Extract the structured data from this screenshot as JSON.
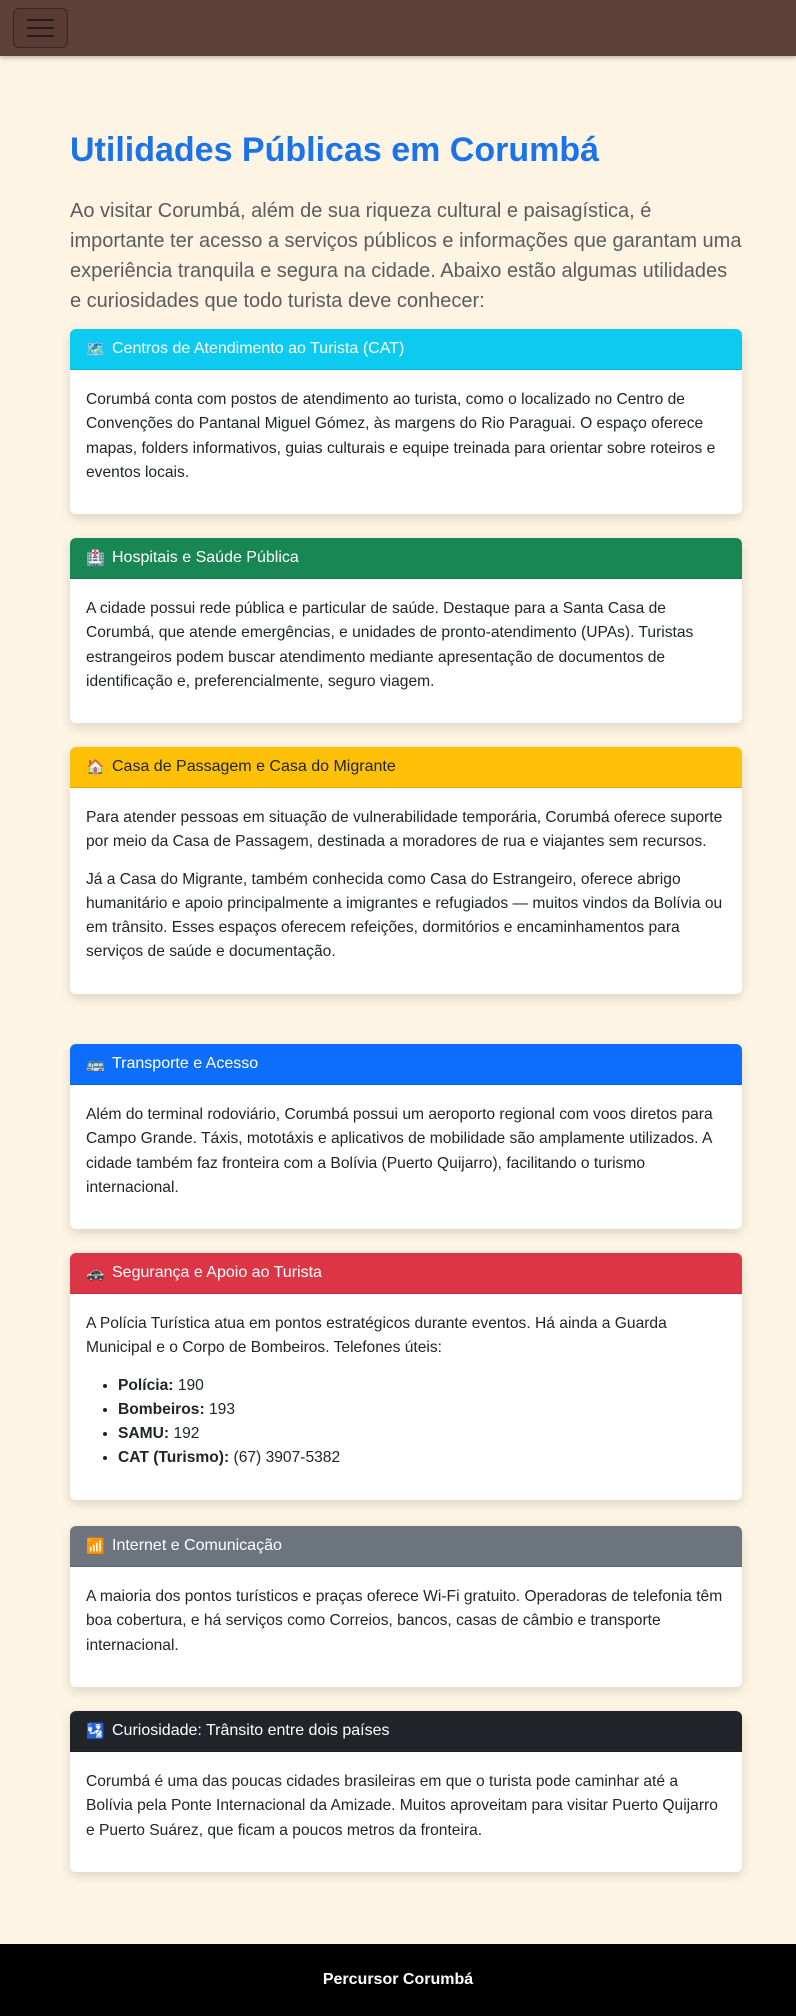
{
  "navbar": {
    "toggle_icon": "hamburger-icon"
  },
  "main": {
    "title": "Utilidades Públicas em Corumbá",
    "intro": "Ao visitar Corumbá, além de sua riqueza cultural e paisagística, é importante ter acesso a serviços públicos e informações que garantam uma experiência tranquila e segura na cidade. Abaixo estão algumas utilidades e curiosidades que todo turista deve conhecer:"
  },
  "cards": [
    {
      "icon": "🗺️",
      "icon_name": "map-icon",
      "header_color": "#0dcaf0",
      "title": "Centros de Atendimento ao Turista (CAT)",
      "paragraphs": [
        "Corumbá conta com postos de atendimento ao turista, como o localizado no Centro de Convenções do Pantanal Miguel Gómez, às margens do Rio Paraguai. O espaço oferece mapas, folders informativos, guias culturais e equipe treinada para orientar sobre roteiros e eventos locais."
      ]
    },
    {
      "icon": "🏥",
      "icon_name": "hospital-icon",
      "header_color": "#198754",
      "title": "Hospitais e Saúde Pública",
      "paragraphs": [
        "A cidade possui rede pública e particular de saúde. Destaque para a Santa Casa de Corumbá, que atende emergências, e unidades de pronto-atendimento (UPAs). Turistas estrangeiros podem buscar atendimento mediante apresentação de documentos de identificação e, preferencialmente, seguro viagem."
      ]
    },
    {
      "icon": "🏠",
      "icon_name": "house-icon",
      "header_color": "#ffc107",
      "title": "Casa de Passagem e Casa do Migrante",
      "paragraphs": [
        "Para atender pessoas em situação de vulnerabilidade temporária, Corumbá oferece suporte por meio da Casa de Passagem, destinada a moradores de rua e viajantes sem recursos.",
        "Já a Casa do Migrante, também conhecida como Casa do Estrangeiro, oferece abrigo humanitário e apoio principalmente a imigrantes e refugiados — muitos vindos da Bolívia ou em trânsito. Esses espaços oferecem refeições, dormitórios e encaminhamentos para serviços de saúde e documentação."
      ]
    },
    {
      "icon": "🚌",
      "icon_name": "bus-icon",
      "header_color": "#0d6efd",
      "title": "Transporte e Acesso",
      "paragraphs": [
        "Além do terminal rodoviário, Corumbá possui um aeroporto regional com voos diretos para Campo Grande. Táxis, mototáxis e aplicativos de mobilidade são amplamente utilizados. A cidade também faz fronteira com a Bolívia (Puerto Quijarro), facilitando o turismo internacional."
      ]
    },
    {
      "icon": "🚓",
      "icon_name": "police-car-icon",
      "header_color": "#dc3545",
      "title": "Segurança e Apoio ao Turista",
      "paragraphs": [
        "A Polícia Turística atua em pontos estratégicos durante eventos. Há ainda a Guarda Municipal e o Corpo de Bombeiros. Telefones úteis:"
      ],
      "phones": [
        {
          "label": "Polícia:",
          "number": "190"
        },
        {
          "label": "Bombeiros:",
          "number": "193"
        },
        {
          "label": "SAMU:",
          "number": "192"
        },
        {
          "label": "CAT (Turismo):",
          "number": "(67) 3907-5382"
        }
      ]
    },
    {
      "icon": "📶",
      "icon_name": "signal-icon",
      "header_color": "#6c757d",
      "title": "Internet e Comunicação",
      "paragraphs": [
        "A maioria dos pontos turísticos e praças oferece Wi-Fi gratuito. Operadoras de telefonia têm boa cobertura, e há serviços como Correios, bancos, casas de câmbio e transporte internacional."
      ]
    },
    {
      "icon": "🛂",
      "icon_name": "passport-control-icon",
      "header_color": "#212529",
      "title": "Curiosidade: Trânsito entre dois países",
      "paragraphs": [
        "Corumbá é uma das poucas cidades brasileiras em que o turista pode caminhar até a Bolívia pela Ponte Internacional da Amizade. Muitos aproveitam para visitar Puerto Quijarro e Puerto Suárez, que ficam a poucos metros da fronteira."
      ]
    }
  ],
  "footer": {
    "text": "Percursor Corumbá"
  }
}
